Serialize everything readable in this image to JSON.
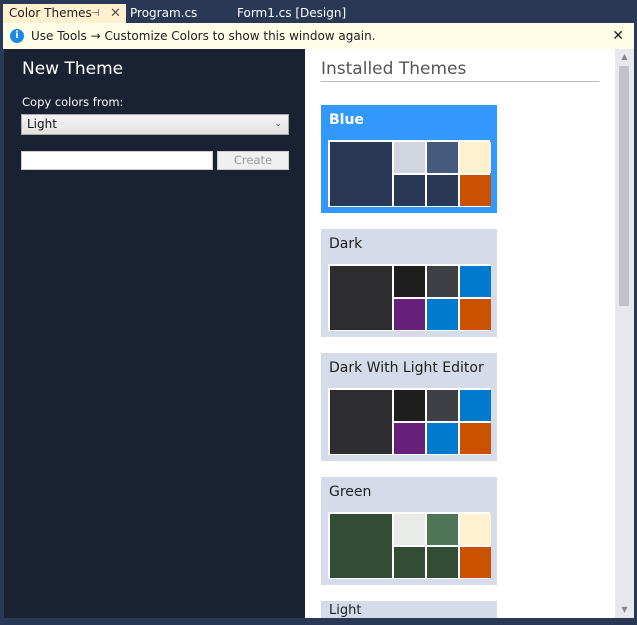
{
  "tabs": [
    {
      "label": "Color Themes",
      "active": true
    },
    {
      "label": "Program.cs"
    },
    {
      "label": "Form1.cs [Design]"
    }
  ],
  "info": {
    "text": "Use Tools → Customize Colors to show this window again.",
    "icon": "info-icon"
  },
  "new_theme": {
    "title": "New Theme",
    "copy_label": "Copy colors from:",
    "copy_value": "Light",
    "name_value": "",
    "create_label": "Create"
  },
  "installed": {
    "title": "Installed Themes",
    "themes": [
      {
        "name": "Blue",
        "selected": true,
        "colors": [
          "#293955",
          "#d0d5df",
          "#465a7d",
          "#fff0d0",
          "#293955",
          "#293955",
          "#ca5100"
        ]
      },
      {
        "name": "Dark",
        "colors": [
          "#2d2d30",
          "#1e1e1e",
          "#3f3f46",
          "#007acc",
          "#68217a",
          "#007acc",
          "#ca5100"
        ]
      },
      {
        "name": "Dark With Light Editor",
        "colors": [
          "#2d2d30",
          "#1e1e1e",
          "#3f3f46",
          "#007acc",
          "#68217a",
          "#007acc",
          "#ca5100"
        ]
      },
      {
        "name": "Green",
        "colors": [
          "#334d35",
          "#e8ebe8",
          "#4e7556",
          "#fff0d0",
          "#334d35",
          "#334d35",
          "#ca5100"
        ]
      },
      {
        "name": "Light",
        "colors": [
          "#eeeef2",
          "#f5f5f5",
          "#cccedb",
          "#007acc",
          "#68217a",
          "#007acc",
          "#ca5100"
        ]
      }
    ]
  }
}
